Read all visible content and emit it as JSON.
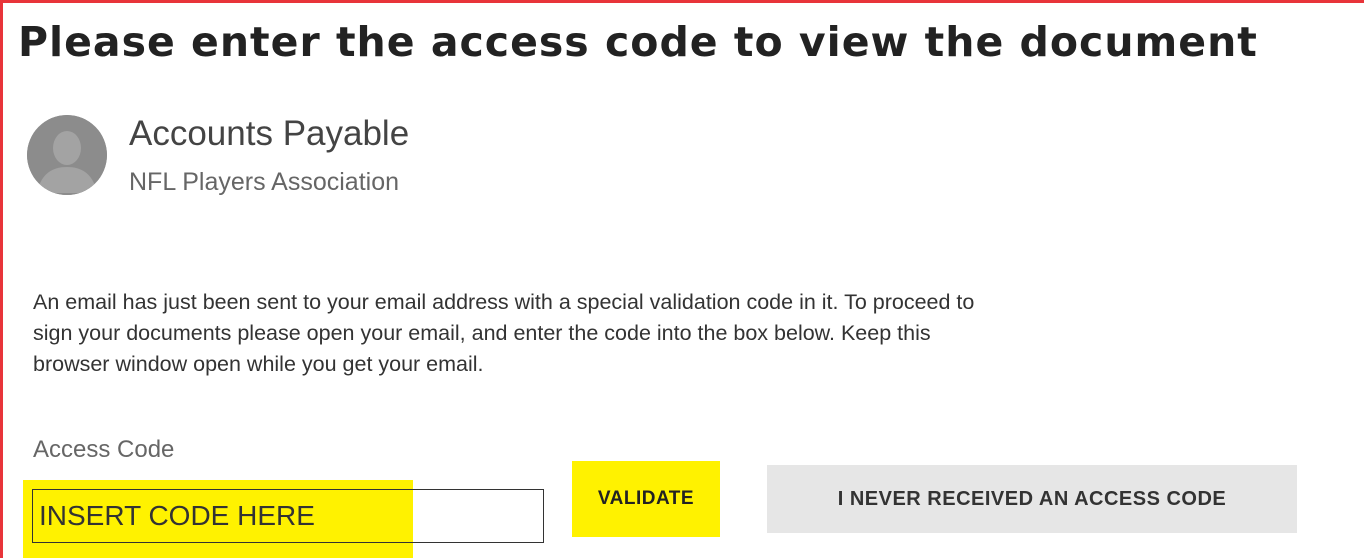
{
  "page": {
    "title": "Please enter the access code to view the document"
  },
  "sender": {
    "name": "Accounts Payable",
    "organization": "NFL Players Association",
    "avatar_icon": "user-silhouette-icon"
  },
  "message": {
    "line1": "An email has just been sent to your email address with a special validation code in it. To proceed to",
    "line2": "sign your documents please open your email, and enter the code into the box below. Keep this",
    "line3": "browser window open while you get your email."
  },
  "form": {
    "access_code_label": "Access Code",
    "access_code_value": "INSERT CODE HERE",
    "validate_label": "VALIDATE",
    "no_code_label": "I NEVER RECEIVED AN ACCESS CODE"
  },
  "colors": {
    "frame_border": "#e8343a",
    "highlight": "#fff200",
    "secondary_button": "#e6e6e6",
    "avatar": "#8a8a8a"
  }
}
